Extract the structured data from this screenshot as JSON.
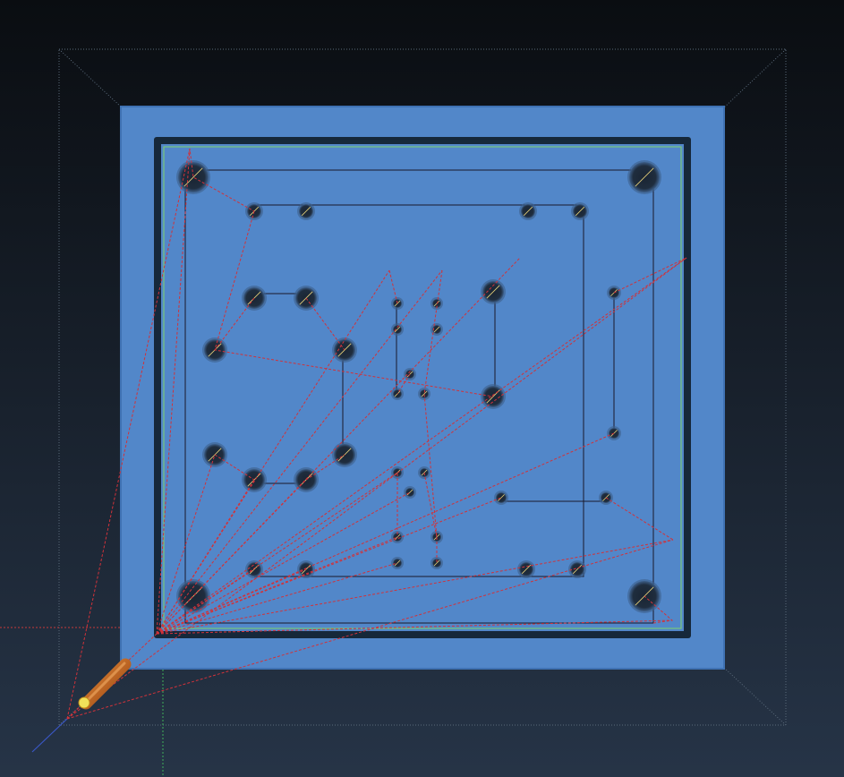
{
  "app": {
    "view": "cam-toolpath-3d-viewport",
    "colors": {
      "background_top": "#0a0d11",
      "background_bottom": "#263447",
      "stock_face": "#5287c9",
      "stock_edge": "#3f72b3",
      "pocket_outline": "#0f1f2e",
      "hole_fill": "#1c2a3a",
      "boundary_green": "#7fd36a",
      "rapid_move": "#d1323a",
      "cut_path": "#1a1a2a",
      "tool_body": "#c7641e",
      "tool_tip": "#f1e15a",
      "guide_line": "#5a6a7a",
      "axis_red": "#c63a3a",
      "axis_green": "#3fae5a",
      "axis_blue": "#3a57c6"
    },
    "icons": {
      "tool": "cutting-tool-icon",
      "tool_tip": "tool-tip-marker-icon"
    }
  }
}
